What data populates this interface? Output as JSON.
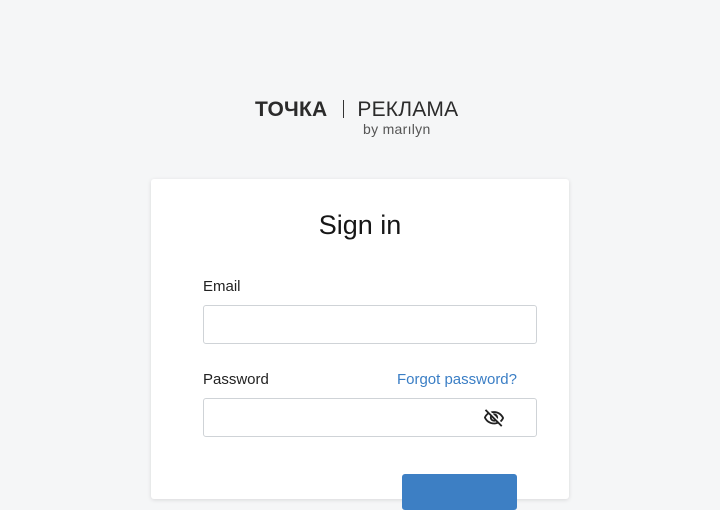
{
  "logo": {
    "brand": "ТОЧКА",
    "product": "РЕКЛАМА",
    "subtitle": "by marılyn"
  },
  "signin": {
    "title": "Sign in",
    "email_label": "Email",
    "email_value": "",
    "password_label": "Password",
    "password_value": "",
    "forgot_label": "Forgot password?",
    "submit_label": ""
  },
  "icons": {
    "password_toggle": "eye-off-icon"
  },
  "colors": {
    "background": "#f5f6f7",
    "link": "#3a7ec5",
    "primary_button": "#3d7fc4",
    "card": "#ffffff"
  }
}
